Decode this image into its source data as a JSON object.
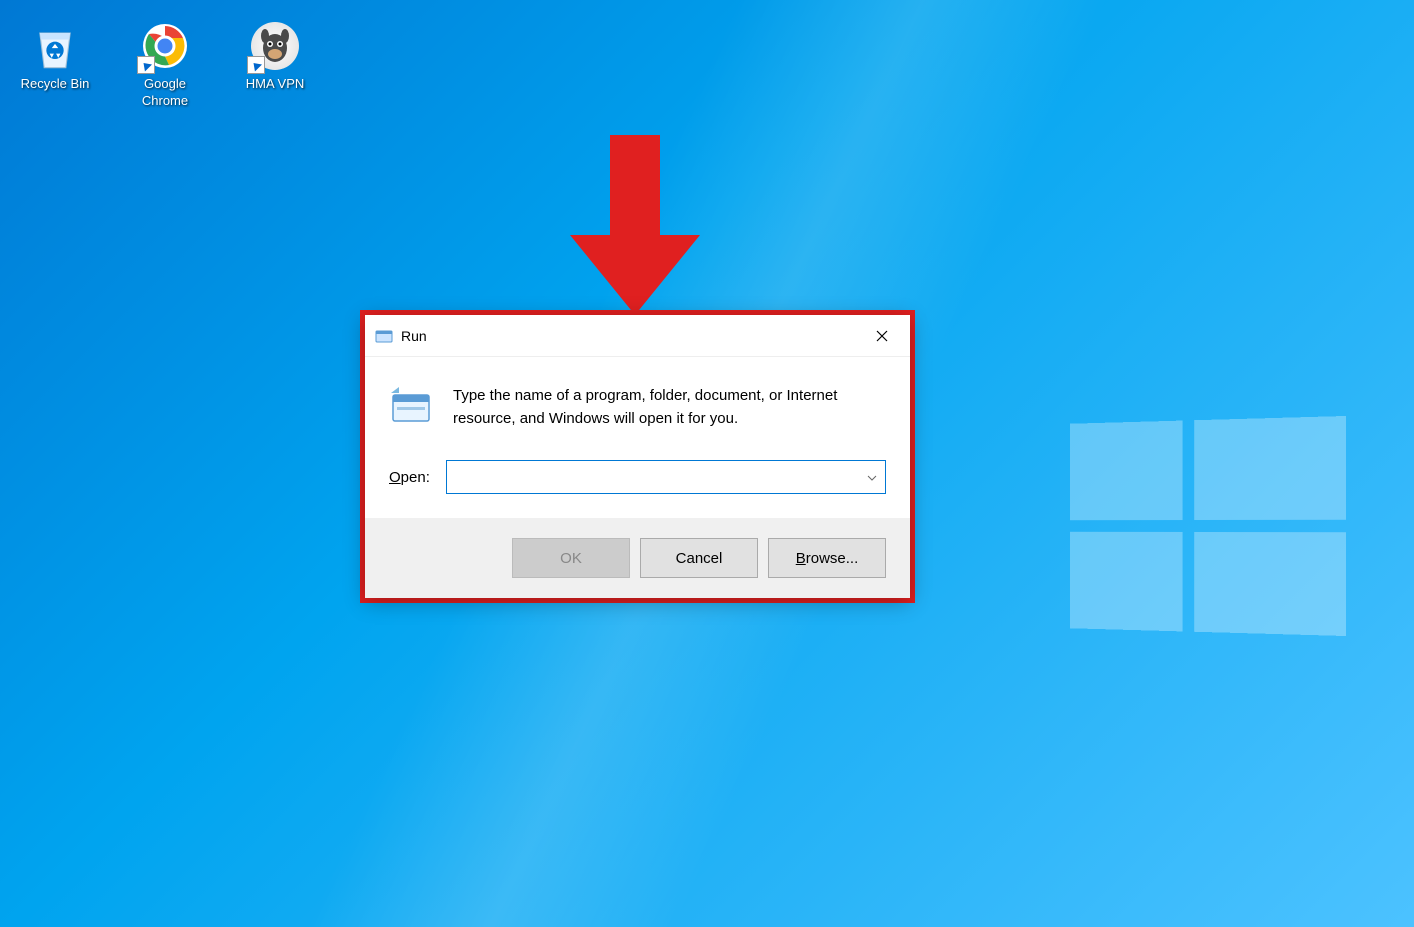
{
  "annotation": {
    "arrow_color": "#e02020",
    "highlight_border_color": "#e02020"
  },
  "desktop": {
    "icons": [
      {
        "label": "Recycle Bin",
        "name": "recycle-bin"
      },
      {
        "label": "Google Chrome",
        "name": "google-chrome"
      },
      {
        "label": "HMA VPN",
        "name": "hma-vpn"
      }
    ]
  },
  "run_dialog": {
    "title": "Run",
    "description": "Type the name of a program, folder, document, or Internet resource, and Windows will open it for you.",
    "open_label_prefix": "O",
    "open_label_rest": "pen:",
    "input_value": "",
    "buttons": {
      "ok": "OK",
      "cancel": "Cancel",
      "browse_prefix": "B",
      "browse_rest": "rowse..."
    }
  }
}
